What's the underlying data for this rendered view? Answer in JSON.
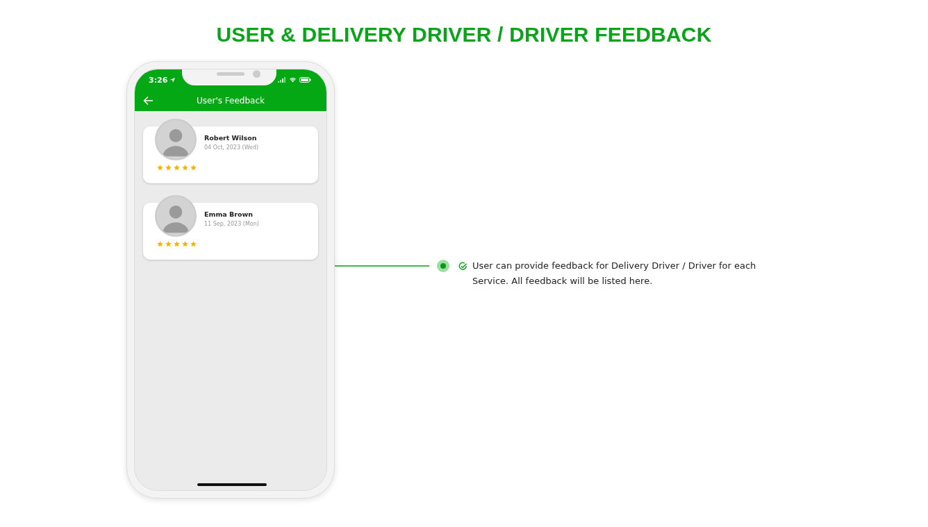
{
  "title": "USER & DELIVERY DRIVER / DRIVER FEEDBACK",
  "phone": {
    "status_time": "3:26",
    "header_title": "User's Feedback",
    "feedback": [
      {
        "name": "Robert Wilson",
        "date": "04 Oct, 2023 (Wed)",
        "stars": 5
      },
      {
        "name": "Emma Brown",
        "date": "11 Sep, 2023 (Mon)",
        "stars": 5
      }
    ]
  },
  "callout": {
    "text": "User can provide feedback for Delivery Driver / Driver for each Service. All feedback will be listed here."
  }
}
